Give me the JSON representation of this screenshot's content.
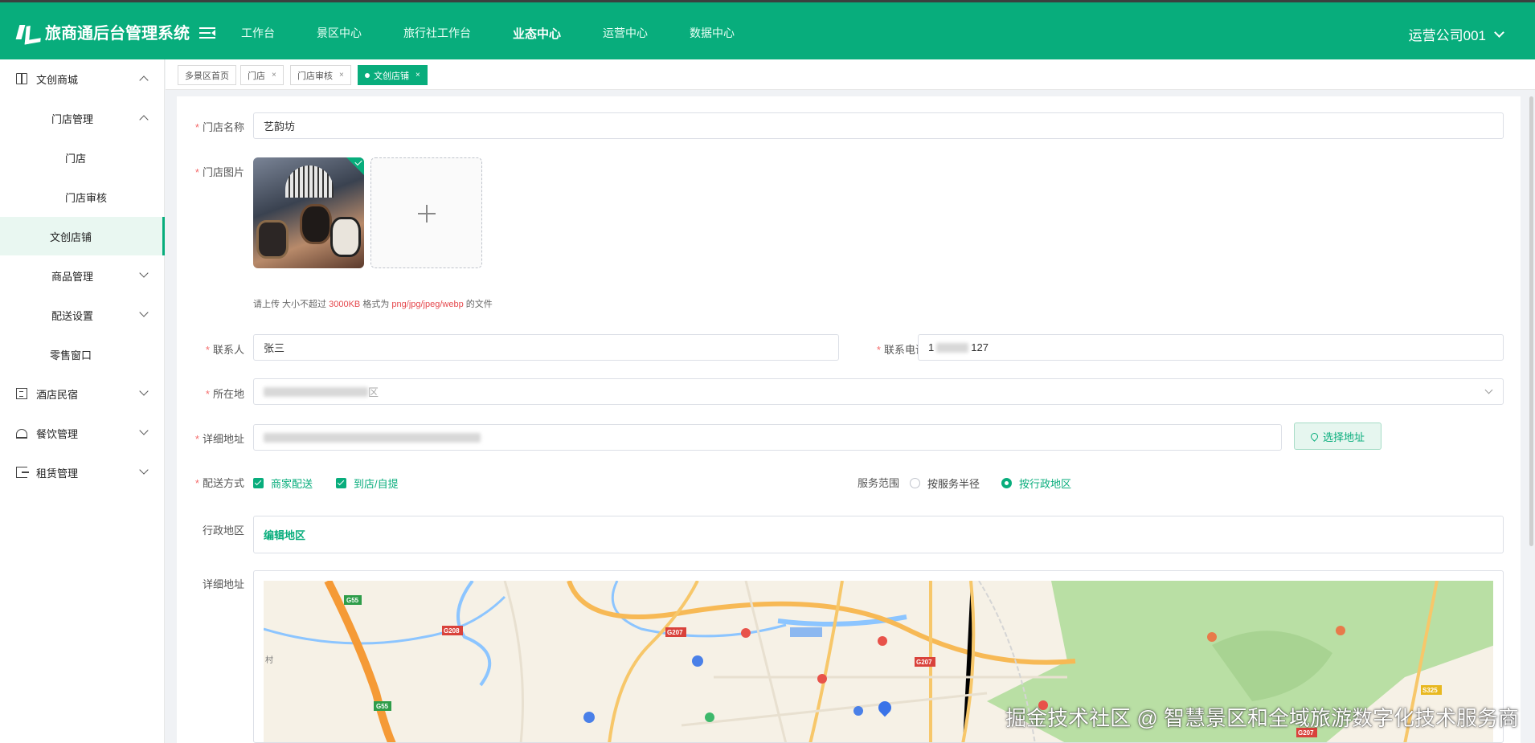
{
  "header": {
    "app_title": "旅商通后台管理系统",
    "nav": [
      "工作台",
      "景区中心",
      "旅行社工作台",
      "业态中心",
      "运营中心",
      "数据中心"
    ],
    "active_nav_index": 3,
    "user_name": "运营公司001"
  },
  "sidebar": {
    "items": [
      {
        "label": "文创商城",
        "icon": "book-icon",
        "level": 1,
        "state": "expanded"
      },
      {
        "label": "门店管理",
        "level": 2,
        "state": "expanded"
      },
      {
        "label": "门店",
        "level": 3
      },
      {
        "label": "门店审核",
        "level": 3
      },
      {
        "label": "文创店铺",
        "level": 2,
        "active": true
      },
      {
        "label": "商品管理",
        "level": 2,
        "state": "collapsed"
      },
      {
        "label": "配送设置",
        "level": 2,
        "state": "collapsed"
      },
      {
        "label": "零售窗口",
        "level": 2
      },
      {
        "label": "酒店民宿",
        "icon": "building-icon",
        "level": 1,
        "state": "collapsed"
      },
      {
        "label": "餐饮管理",
        "icon": "bell-icon",
        "level": 1,
        "state": "collapsed"
      },
      {
        "label": "租赁管理",
        "icon": "exit-icon",
        "level": 1,
        "state": "collapsed"
      }
    ]
  },
  "tabs": [
    {
      "label": "多景区首页",
      "closable": false
    },
    {
      "label": "门店",
      "closable": true
    },
    {
      "label": "门店审核",
      "closable": true
    },
    {
      "label": "文创店铺",
      "closable": true,
      "active": true
    }
  ],
  "tab_close_glyph": "×",
  "form": {
    "store_name_label": "门店名称",
    "store_name_value": "艺韵坊",
    "store_image_label": "门店图片",
    "upload_tip_prefix": "请上传 大小不超过 ",
    "upload_tip_size": "3000KB",
    "upload_tip_mid": " 格式为 ",
    "upload_tip_formats": "png/jpg/jpeg/webp",
    "upload_tip_suffix": " 的文件",
    "contact_label": "联系人",
    "contact_value": "张三",
    "phone_label": "联系电话",
    "phone_prefix": "1",
    "phone_suffix": "127",
    "location_label": "所在地",
    "location_tail": "区",
    "address_label": "详细地址",
    "select_address_button": "选择地址",
    "delivery_label": "配送方式",
    "delivery_options": [
      {
        "label": "商家配送",
        "checked": true
      },
      {
        "label": "到店/自提",
        "checked": true
      }
    ],
    "service_range_label": "服务范围",
    "service_range_options": [
      {
        "label": "按服务半径",
        "selected": false
      },
      {
        "label": "按行政地区",
        "selected": true
      }
    ],
    "admin_region_label": "行政地区",
    "edit_region_link": "编辑地区",
    "map_address_label": "详细地址"
  },
  "map": {
    "road_labels": [
      "G55",
      "G208",
      "G207",
      "G207",
      "G55",
      "S325",
      "G207"
    ],
    "place_text": "村"
  },
  "watermark": "掘金技术社区 @ 智慧景区和全域旅游数字化技术服务商",
  "colors": {
    "brand": "#08ad7c",
    "required": "#f56c6c",
    "tip_highlight": "#e5484d"
  }
}
